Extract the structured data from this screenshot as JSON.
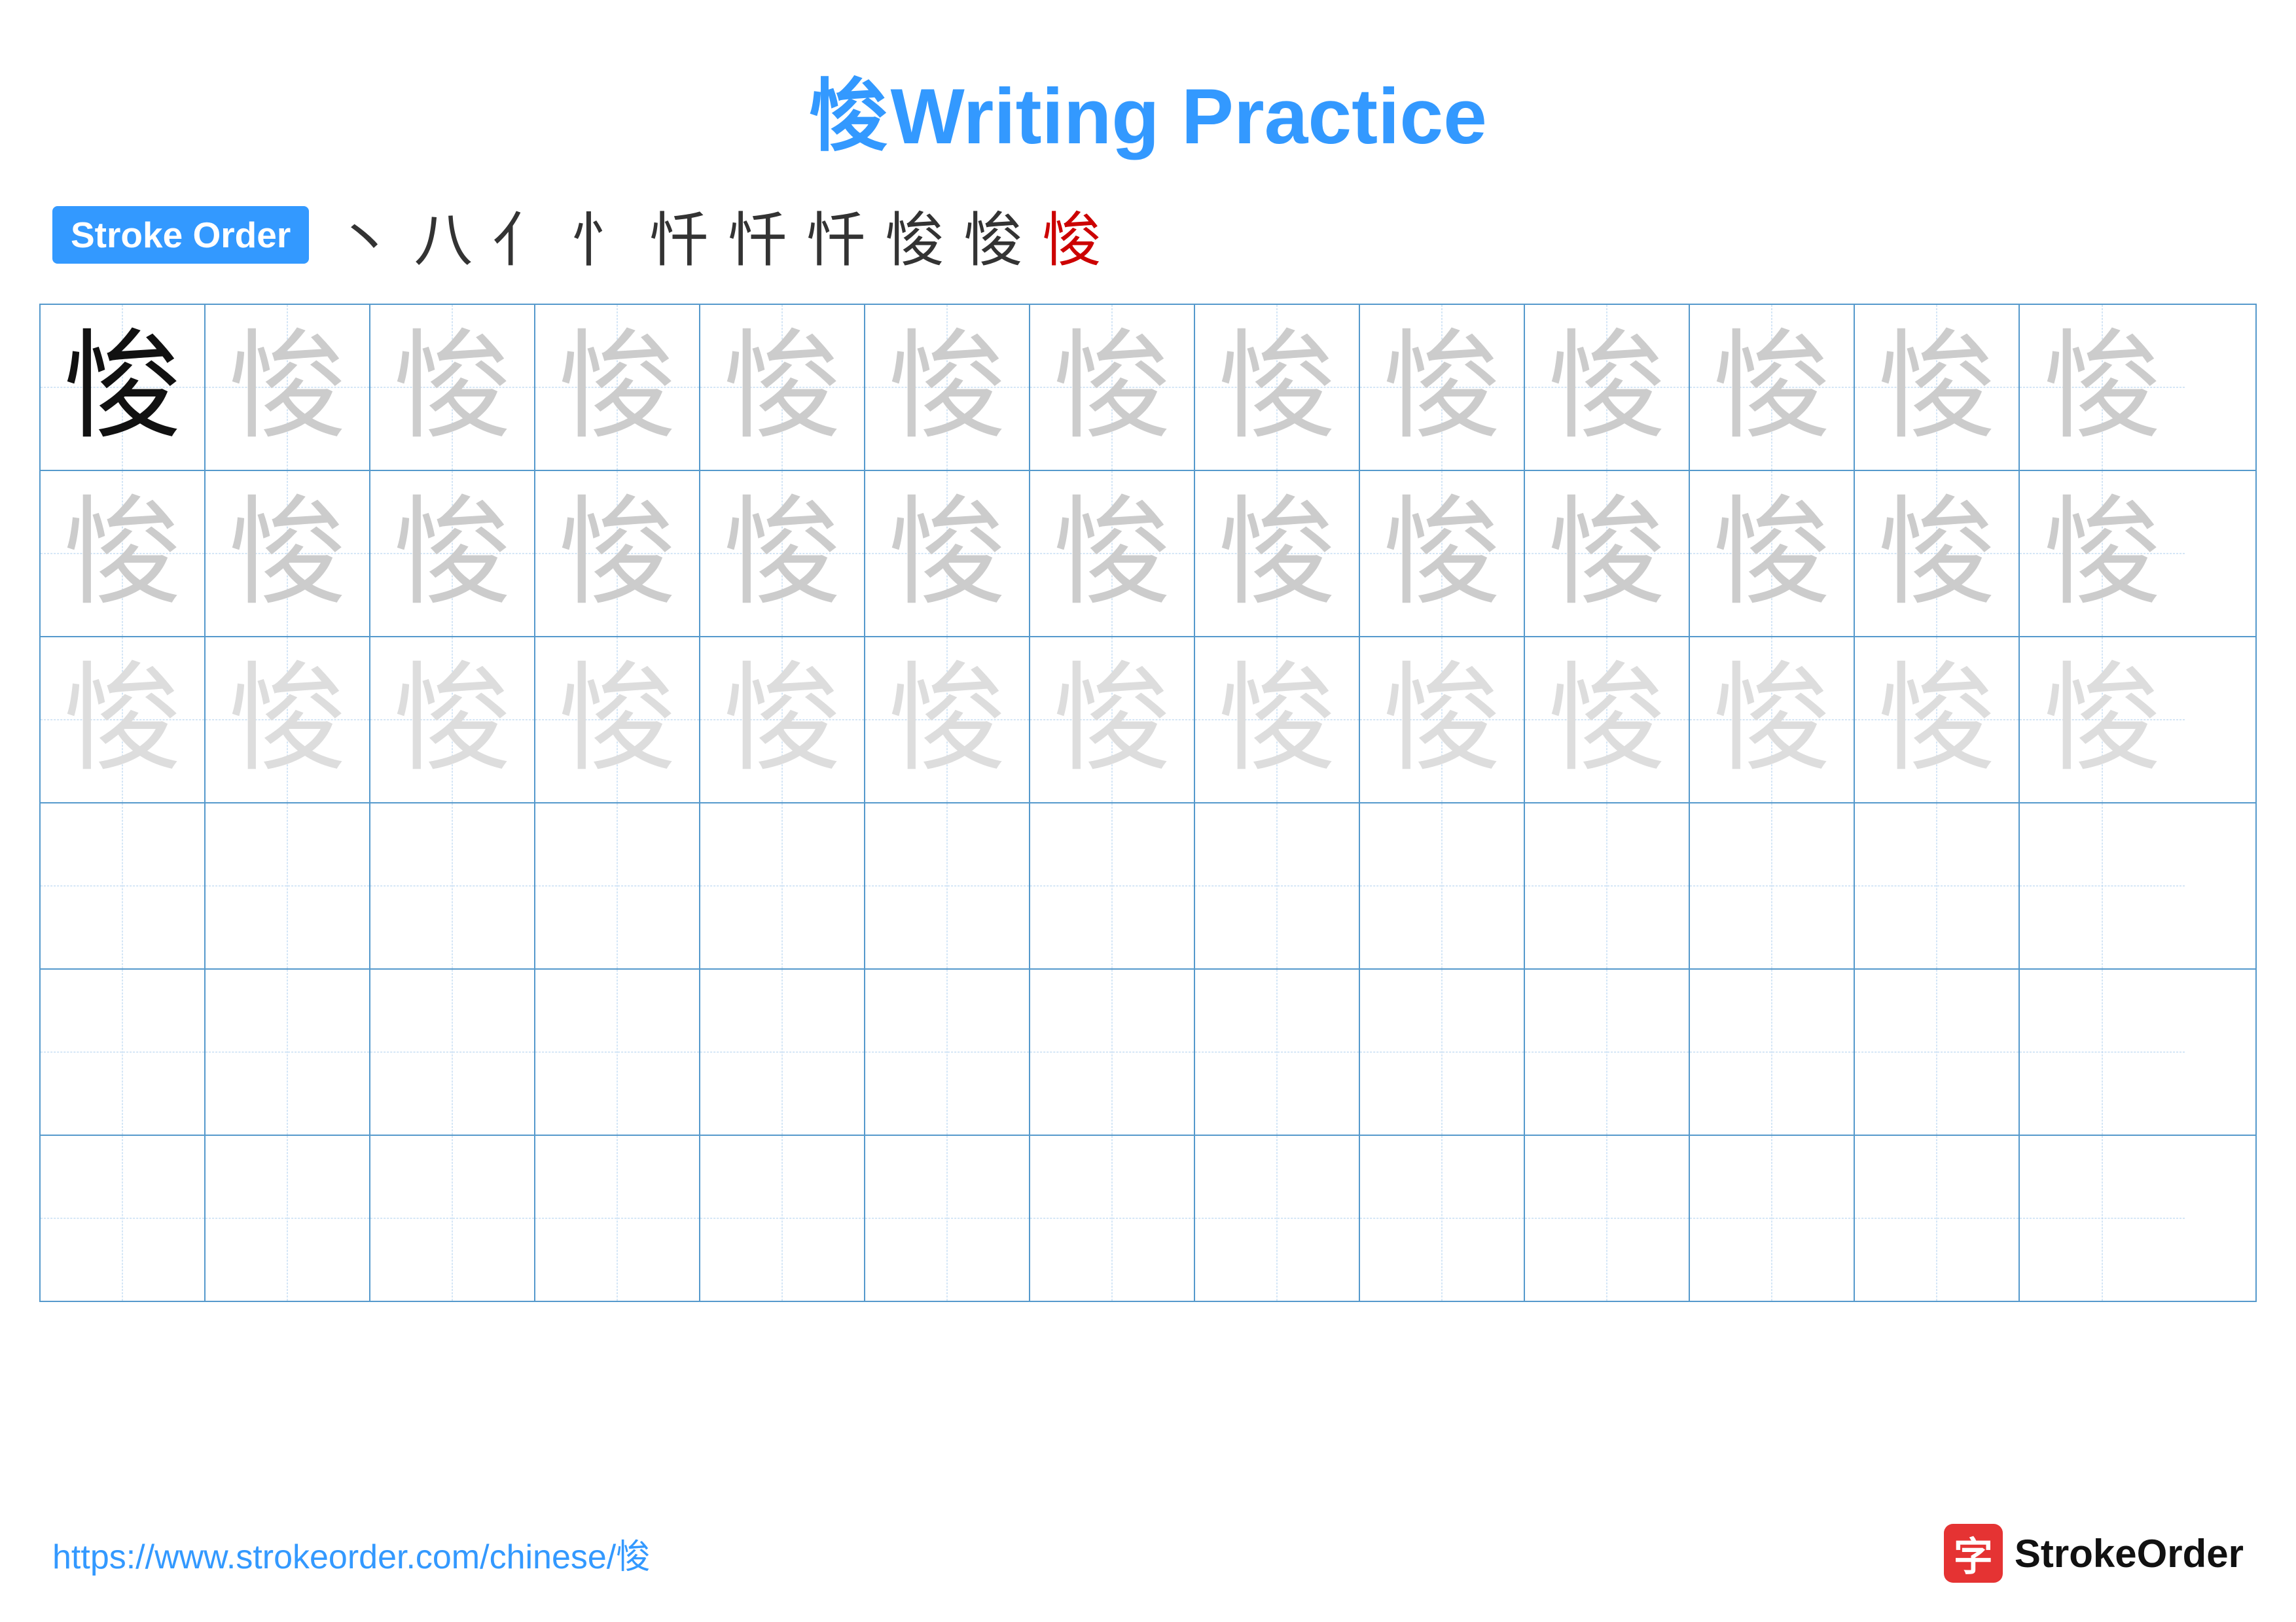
{
  "title": {
    "char": "悛",
    "text": "Writing Practice"
  },
  "strokeOrder": {
    "badge": "Stroke Order",
    "strokes": [
      "丶",
      "八",
      "亻",
      "忄",
      "忏",
      "忏",
      "忏",
      "悛",
      "悛",
      "悛"
    ]
  },
  "grid": {
    "rows": 6,
    "cols": 13,
    "char": "悛",
    "row1_first_dark": true,
    "row1_rest_medium": true,
    "row2_light": true,
    "row3_lighter": true
  },
  "footer": {
    "url": "https://www.strokeorder.com/chinese/悛",
    "logo_text": "StrokeOrder"
  }
}
